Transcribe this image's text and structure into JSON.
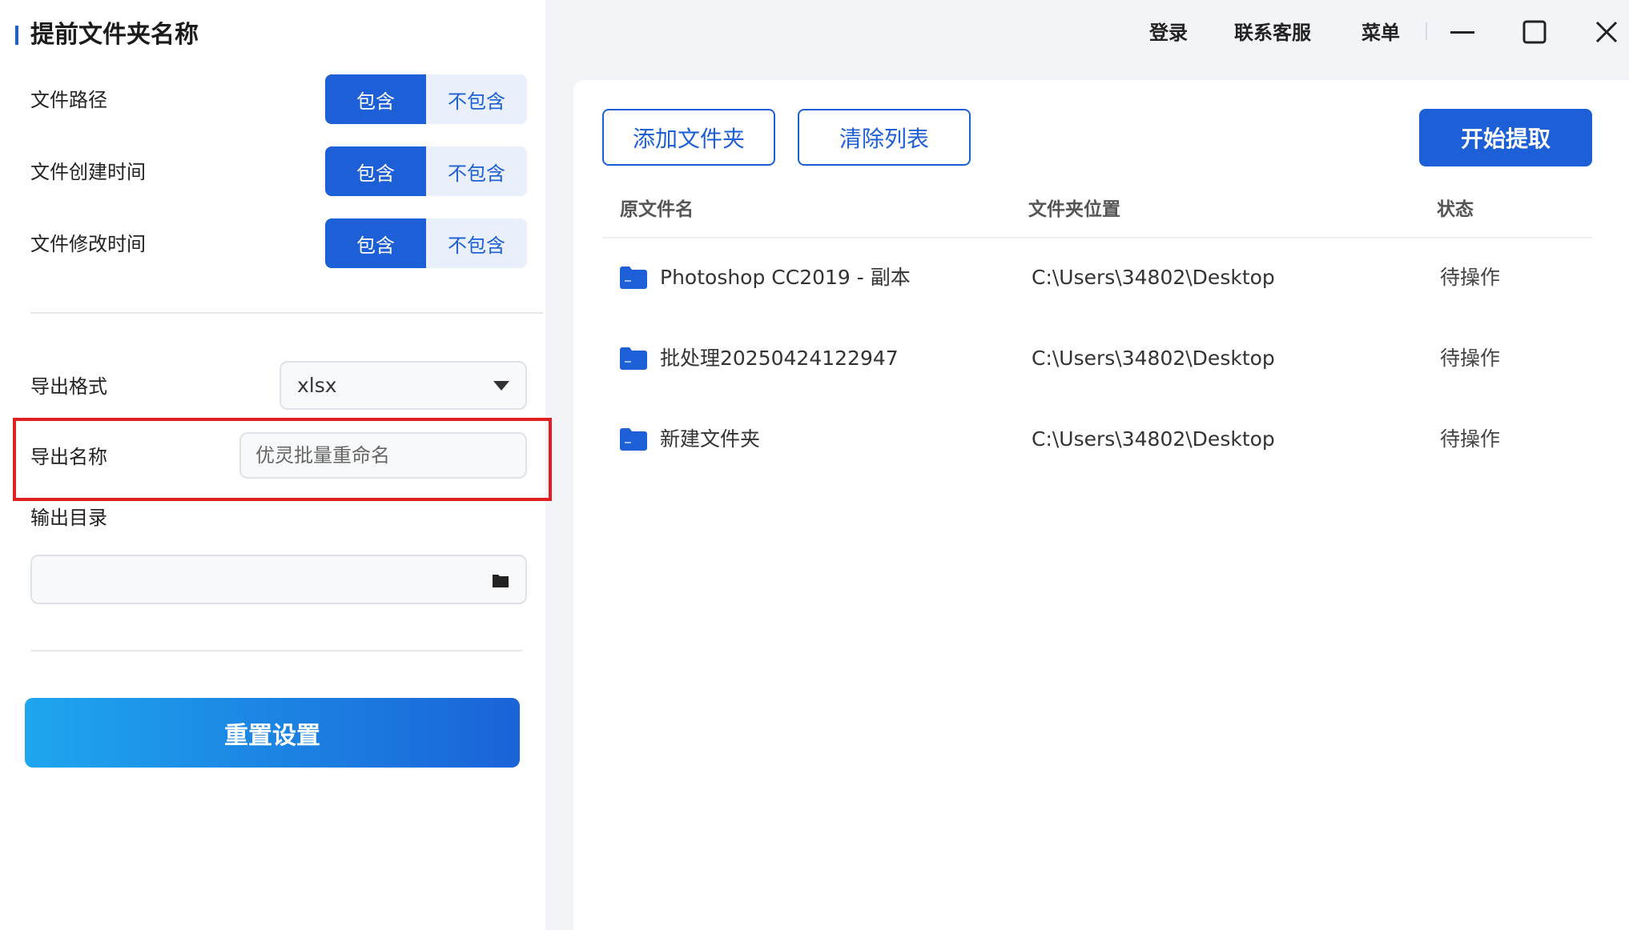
{
  "panel": {
    "title": "提前文件夹名称",
    "options": [
      {
        "label": "文件路径",
        "on": "包含",
        "off": "不包含"
      },
      {
        "label": "文件创建时间",
        "on": "包含",
        "off": "不包含"
      },
      {
        "label": "文件修改时间",
        "on": "包含",
        "off": "不包含"
      }
    ],
    "export_format_label": "导出格式",
    "export_format_value": "xlsx",
    "export_name_label": "导出名称",
    "export_name_placeholder": "优灵批量重命名",
    "output_dir_label": "输出目录",
    "output_dir_value": "",
    "reset_button": "重置设置"
  },
  "topbar": {
    "login": "登录",
    "support": "联系客服",
    "menu": "菜单"
  },
  "toolbar": {
    "add_folder": "添加文件夹",
    "clear_list": "清除列表",
    "start": "开始提取"
  },
  "table": {
    "headers": [
      "原文件名",
      "文件夹位置",
      "状态"
    ],
    "rows": [
      {
        "name": "Photoshop CC2019 - 副本",
        "path": "C:\\Users\\34802\\Desktop",
        "status": "待操作"
      },
      {
        "name": "批处理20250424122947",
        "path": "C:\\Users\\34802\\Desktop",
        "status": "待操作"
      },
      {
        "name": "新建文件夹",
        "path": "C:\\Users\\34802\\Desktop",
        "status": "待操作"
      }
    ]
  },
  "colors": {
    "accent": "#1d5fd6",
    "highlight_border": "#e02020"
  },
  "icons": [
    "folder-icon",
    "minimize-icon",
    "maximize-icon",
    "close-icon",
    "dropdown-caret-icon",
    "folder-browse-icon"
  ]
}
